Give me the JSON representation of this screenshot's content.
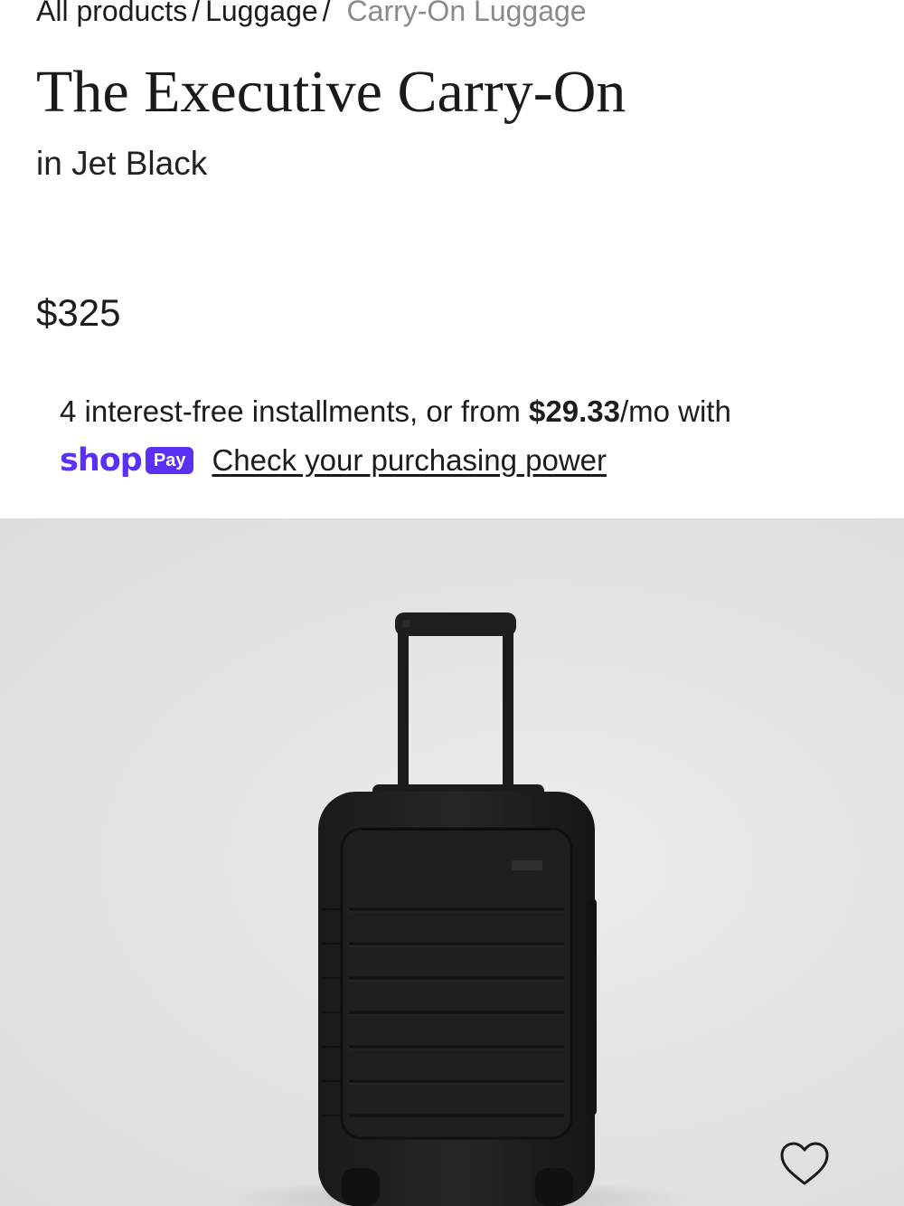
{
  "breadcrumb": {
    "items": [
      {
        "label": "All products"
      },
      {
        "label": "Luggage"
      }
    ],
    "separator": "/",
    "current": "Carry-On Luggage"
  },
  "product": {
    "title": "The Executive Carry-On",
    "color_variant": "in Jet Black",
    "price": "$325"
  },
  "financing": {
    "prefix": "4 interest-free installments, or from ",
    "amount": "$29.33",
    "suffix": "/mo with",
    "brand_word": "shop",
    "brand_badge": "Pay",
    "link_label": "Check your purchasing power",
    "brand_color": "#5a31f4"
  },
  "gallery": {
    "image_subject": "luggage-image",
    "wishlist_icon": "heart-outline-icon"
  }
}
